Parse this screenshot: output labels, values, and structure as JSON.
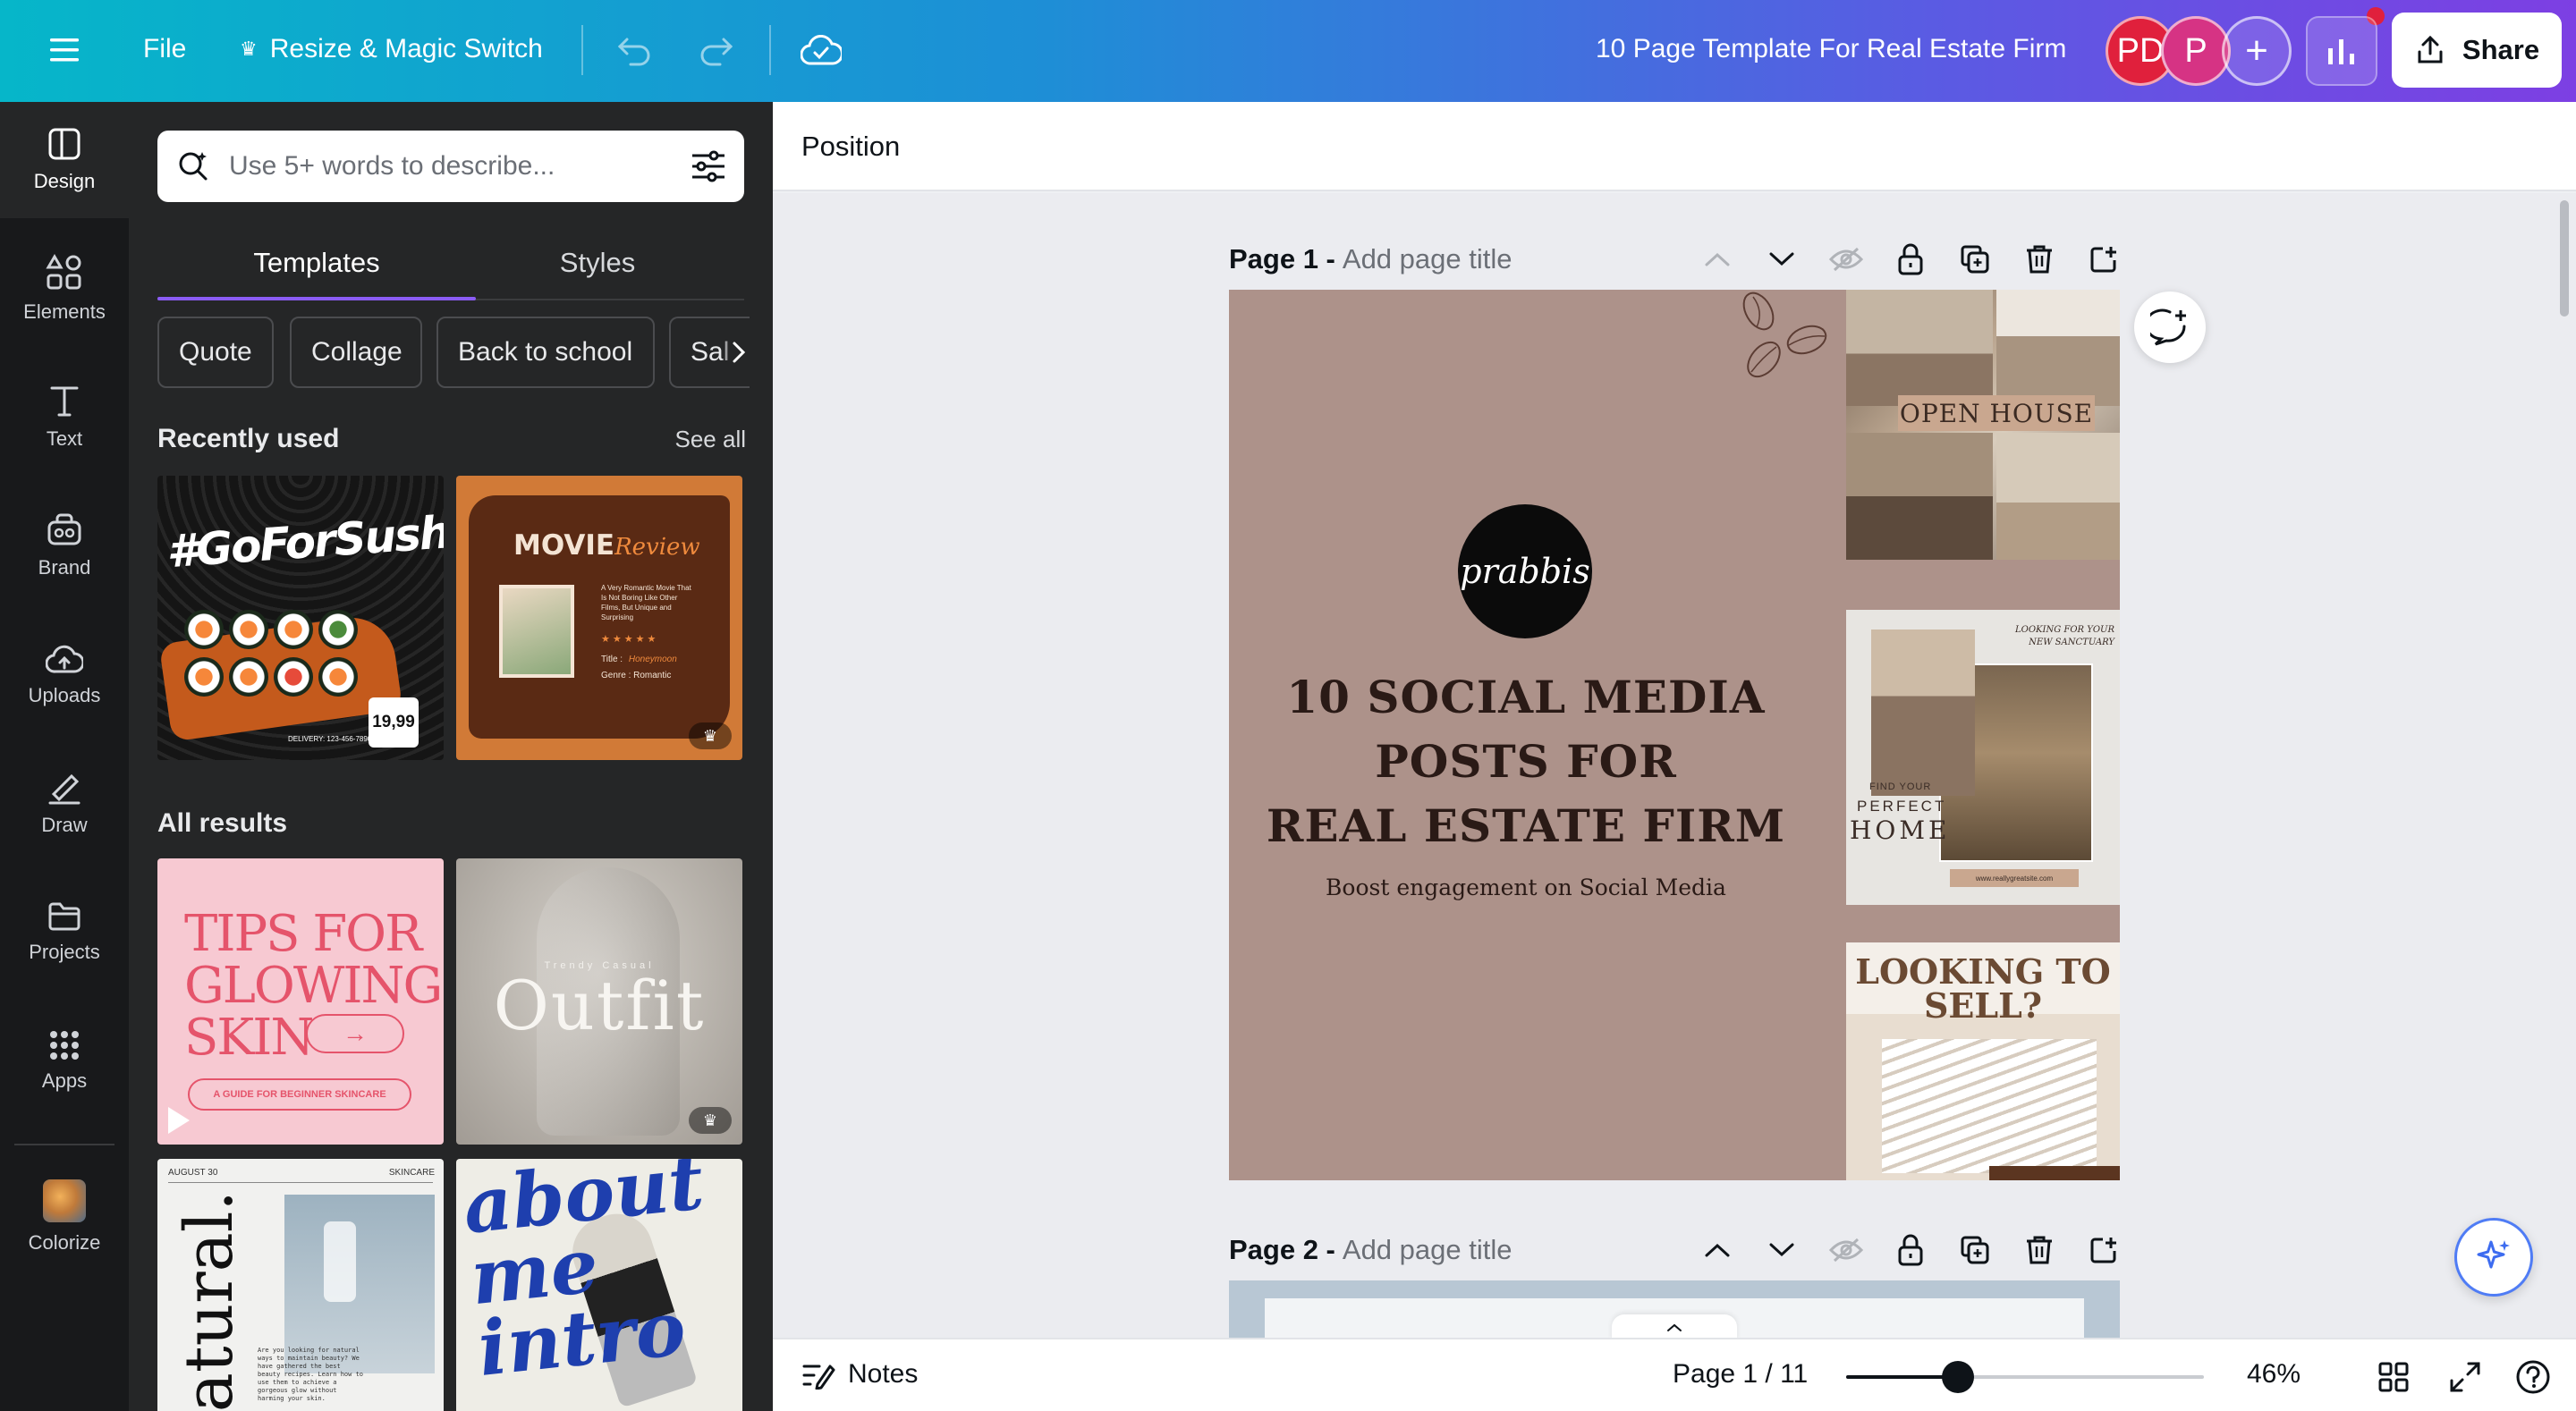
{
  "topbar": {
    "file_label": "File",
    "resize_label": "Resize & Magic Switch",
    "doc_title": "10 Page Template For Real Estate Firm",
    "avatar1": "PD",
    "avatar2": "P",
    "share_label": "Share",
    "colors": {
      "avatar1": "#e0203c",
      "avatar2": "#d63384"
    }
  },
  "rail": {
    "items": [
      {
        "label": "Design",
        "icon": "design-icon"
      },
      {
        "label": "Elements",
        "icon": "elements-icon"
      },
      {
        "label": "Text",
        "icon": "text-icon"
      },
      {
        "label": "Brand",
        "icon": "brand-icon"
      },
      {
        "label": "Uploads",
        "icon": "uploads-icon"
      },
      {
        "label": "Draw",
        "icon": "draw-icon"
      },
      {
        "label": "Projects",
        "icon": "projects-icon"
      },
      {
        "label": "Apps",
        "icon": "apps-icon"
      },
      {
        "label": "Colorize",
        "icon": "colorize-icon"
      }
    ]
  },
  "panel": {
    "search_placeholder": "Use 5+ words to describe...",
    "tabs": [
      "Templates",
      "Styles"
    ],
    "chips": [
      "Quote",
      "Collage",
      "Back to school",
      "Sal"
    ],
    "recently_used": "Recently used",
    "see_all": "See all",
    "all_results": "All results",
    "thumbs": {
      "sushi_text": "#GoForSushi!",
      "sushi_price": "19,99",
      "sushi_phone": "DELIVERY: 123-456-7890",
      "movie_word1": "MOVIE",
      "movie_word2": "Review",
      "movie_desc": "A Very Romantic Movie That Is Not Boring Like Other Films, But Unique and Surprising",
      "movie_title_line": "Title :",
      "movie_title_value": "Honeymoon",
      "movie_genre_line": "Genre : Romantic",
      "skin_title": "TIPS FOR GLOWING SKIN",
      "skin_sub": "A GUIDE FOR BEGINNER SKINCARE",
      "outfit_small": "Trendy Casual",
      "outfit_big": "Outfit",
      "natural_date": "AUGUST 30",
      "natural_tag": "SKINCARE",
      "natural_big": "natural.",
      "natural_body": "Are you looking for natural ways to maintain beauty? We have gathered the best beauty recipes. Learn how to use them to achieve a gorgeous glow without harming your skin.",
      "about_text": "about me intro"
    }
  },
  "context_bar": {
    "position_label": "Position"
  },
  "pages": [
    {
      "label": "Page 1 -",
      "title_placeholder": "Add page title"
    },
    {
      "label": "Page 2 -",
      "title_placeholder": "Add page title"
    }
  ],
  "design": {
    "logo_text": "prabbis",
    "headline_lines": [
      "10 SOCIAL MEDIA",
      "POSTS FOR",
      "REAL ESTATE FIRM"
    ],
    "subline": "Boost engagement on Social Media",
    "open_house": "OPEN HOUSE",
    "sanctuary": "LOOKING FOR YOUR NEW SANCTUARY",
    "find_your": "FIND YOUR",
    "perfect": "PERFECT",
    "home": "HOME",
    "site_url": "www.reallygreatsite.com",
    "looking_to_sell": "LOOKING TO SELL?",
    "bg_color": "#ad928a"
  },
  "bottombar": {
    "notes_label": "Notes",
    "page_indicator": "Page 1 / 11",
    "zoom_percent": 46,
    "zoom_label": "46%"
  }
}
